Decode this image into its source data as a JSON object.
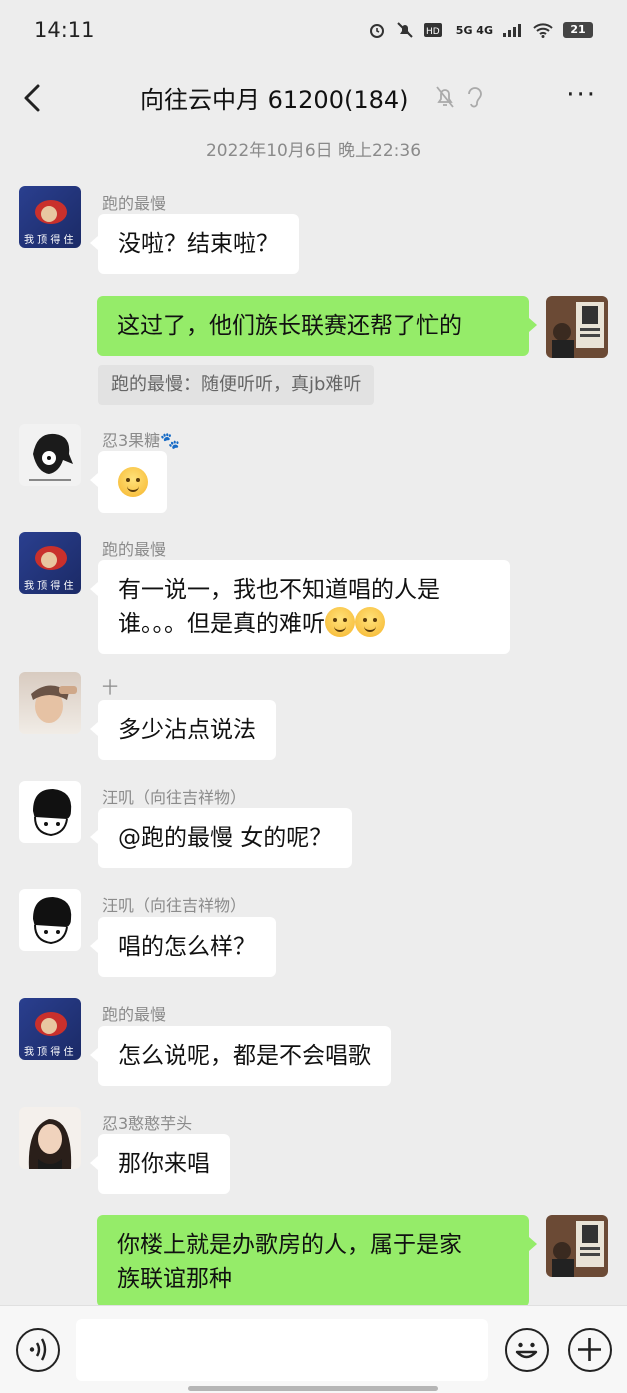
{
  "status_bar": {
    "time": "14:11",
    "network": "5G 4G",
    "battery": "21"
  },
  "header": {
    "title": "向往云中月 61200(184)",
    "more": "···"
  },
  "timestamp": "2022年10月6日 晚上22:36",
  "messages": [
    {
      "sender": "跑的最慢",
      "text": "没啦？结束啦？"
    },
    {
      "text": "这过了，他们族长联赛还帮了忙的",
      "quote": "跑的最慢：随便听听，真jb难听"
    },
    {
      "sender": "忍3果糖🐾",
      "text": ""
    },
    {
      "sender": "跑的最慢",
      "line1": "有一说一，我也不知道唱的人是",
      "line2": "谁。。。但是真的难听"
    },
    {
      "sender": "十",
      "text": "多少沾点说法"
    },
    {
      "sender": "汪叽（向往吉祥物）",
      "text": "@跑的最慢  女的呢？"
    },
    {
      "sender": "汪叽（向往吉祥物）",
      "text": "唱的怎么样？"
    },
    {
      "sender": "跑的最慢",
      "text": "怎么说呢，都是不会唱歌"
    },
    {
      "sender": "忍3憨憨芋头",
      "text": "那你来唱"
    },
    {
      "line1": "你楼上就是办歌房的人，属于是家",
      "line2": "族联谊那种"
    }
  ],
  "avatar_labels": {
    "paodezuiman": "我 顶 得 住"
  },
  "colors": {
    "background": "#ededed",
    "my_bubble": "#95ec69",
    "other_bubble": "#ffffff"
  }
}
